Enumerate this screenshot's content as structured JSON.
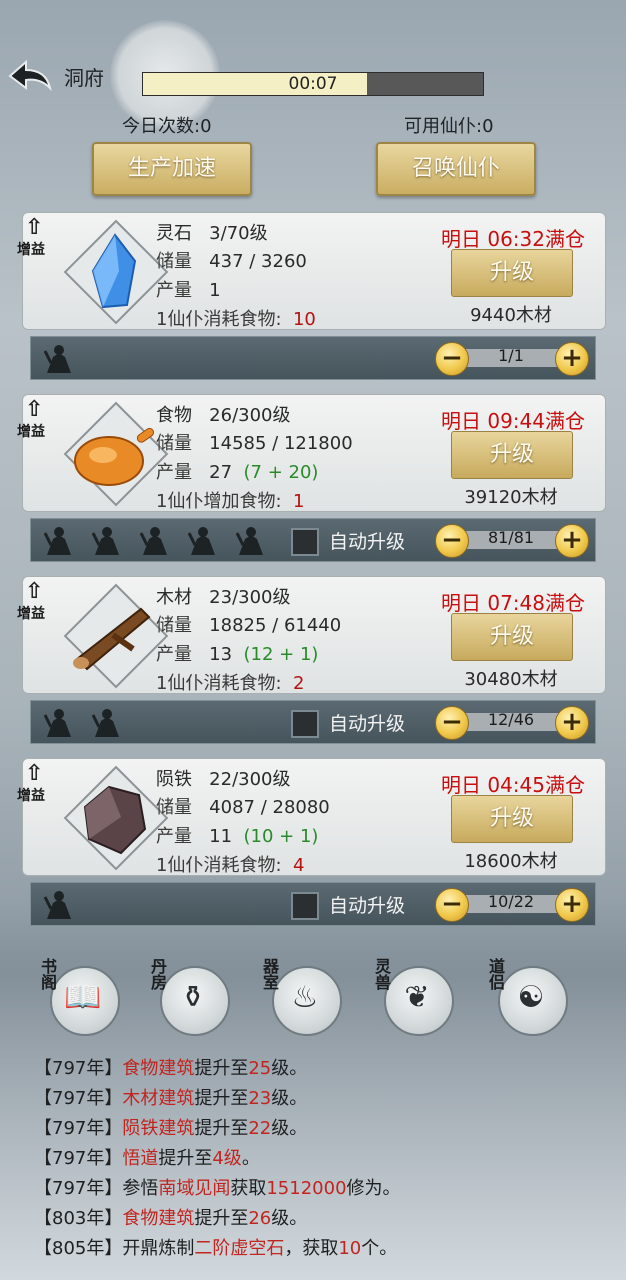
{
  "header": {
    "title": "洞府",
    "timer": "00:07",
    "timer_progress": 0.66
  },
  "summary": {
    "today_count": "今日次数:0",
    "available_servants": "可用仙仆:0"
  },
  "actions": {
    "speed_up": "生产加速",
    "summon": "召唤仙仆"
  },
  "badge_label": "增益",
  "upgrade_label": "升级",
  "auto_upgrade_label": "自动升级",
  "buildings": [
    {
      "name": "灵石",
      "level": "3/70级",
      "storage_label": "储量",
      "storage": "437 / 3260",
      "output_label": "产量",
      "output": "1",
      "output_bonus": "",
      "food_label": "1仙仆消耗食物:",
      "food_value": "10",
      "deadline": "明日 06:32满仓",
      "cost": "9440木材",
      "workers": "1/1",
      "worker_count": 1,
      "auto": false
    },
    {
      "name": "食物",
      "level": "26/300级",
      "storage_label": "储量",
      "storage": "14585 / 121800",
      "output_label": "产量",
      "output": "27",
      "output_bonus": "(7 + 20)",
      "food_label": "1仙仆增加食物:",
      "food_value": "1",
      "deadline": "明日 09:44满仓",
      "cost": "39120木材",
      "workers": "81/81",
      "worker_count": 5,
      "auto": true
    },
    {
      "name": "木材",
      "level": "23/300级",
      "storage_label": "储量",
      "storage": "18825 / 61440",
      "output_label": "产量",
      "output": "13",
      "output_bonus": "(12 + 1)",
      "food_label": "1仙仆消耗食物:",
      "food_value": "2",
      "deadline": "明日 07:48满仓",
      "cost": "30480木材",
      "workers": "12/46",
      "worker_count": 2,
      "auto": true
    },
    {
      "name": "陨铁",
      "level": "22/300级",
      "storage_label": "储量",
      "storage": "4087 / 28080",
      "output_label": "产量",
      "output": "11",
      "output_bonus": "(10 + 1)",
      "food_label": "1仙仆消耗食物:",
      "food_value": "4",
      "deadline": "明日 04:45满仓",
      "cost": "18600木材",
      "workers": "10/22",
      "worker_count": 1,
      "auto": true
    }
  ],
  "nav": [
    {
      "label": "书阁",
      "icon": "book-icon"
    },
    {
      "label": "丹房",
      "icon": "cauldron-icon"
    },
    {
      "label": "器室",
      "icon": "forge-icon"
    },
    {
      "label": "灵兽",
      "icon": "phoenix-icon"
    },
    {
      "label": "道侣",
      "icon": "partner-icon"
    }
  ],
  "log": [
    [
      {
        "t": "【797年】"
      },
      {
        "t": "食物建筑",
        "h": true
      },
      {
        "t": "提升至"
      },
      {
        "t": "25",
        "h": true
      },
      {
        "t": "级。"
      }
    ],
    [
      {
        "t": "【797年】"
      },
      {
        "t": "木材建筑",
        "h": true
      },
      {
        "t": "提升至"
      },
      {
        "t": "23",
        "h": true
      },
      {
        "t": "级。"
      }
    ],
    [
      {
        "t": "【797年】"
      },
      {
        "t": "陨铁建筑",
        "h": true
      },
      {
        "t": "提升至"
      },
      {
        "t": "22",
        "h": true
      },
      {
        "t": "级。"
      }
    ],
    [
      {
        "t": "【797年】"
      },
      {
        "t": "悟道",
        "h": true
      },
      {
        "t": "提升至"
      },
      {
        "t": "4级",
        "h": true
      },
      {
        "t": "。"
      }
    ],
    [
      {
        "t": "【797年】参悟"
      },
      {
        "t": "南域见闻",
        "h": true
      },
      {
        "t": "获取"
      },
      {
        "t": "1512000",
        "h": true
      },
      {
        "t": "修为。"
      }
    ],
    [
      {
        "t": "【803年】"
      },
      {
        "t": "食物建筑",
        "h": true
      },
      {
        "t": "提升至"
      },
      {
        "t": "26",
        "h": true
      },
      {
        "t": "级。"
      }
    ],
    [
      {
        "t": "【805年】开鼎炼制"
      },
      {
        "t": "二阶虚空石",
        "h": true
      },
      {
        "t": "，获取"
      },
      {
        "t": "10",
        "h": true
      },
      {
        "t": "个。"
      }
    ]
  ],
  "colors": {
    "accent_gold": "#c9ad62",
    "alert_red": "#c80f0f",
    "bonus_green": "#2a8a2a",
    "log_highlight": "#c2251f"
  }
}
